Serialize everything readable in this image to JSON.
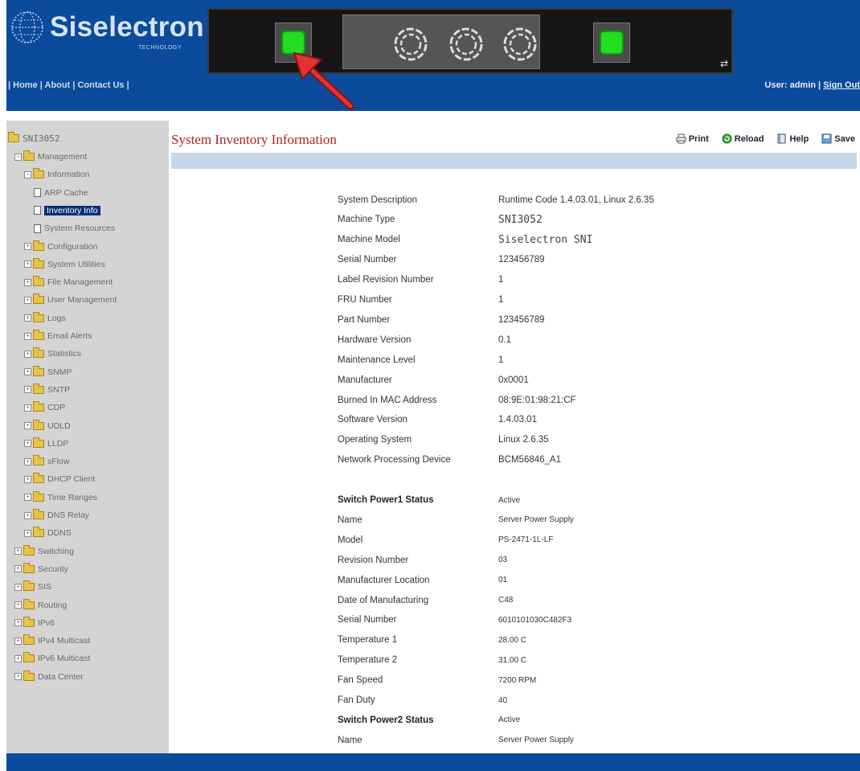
{
  "brand": {
    "name": "Siselectron",
    "subtitle": "TECHNOLOGY"
  },
  "header_nav": {
    "home": "Home",
    "about": "About",
    "contact": "Contact Us",
    "sep": "|"
  },
  "user_area": {
    "label": "User: admin",
    "sep": "|",
    "sign_out": "Sign Out"
  },
  "device_panel": {
    "psu_icon": "power-supply-icon",
    "fan_icon": "fan-icon",
    "sync_glyph": "⇄"
  },
  "sidebar": {
    "root": "SNI3052",
    "items": [
      {
        "label": "Management",
        "type": "folder",
        "expand": "−"
      },
      {
        "label": "Information",
        "type": "folder",
        "expand": "−"
      },
      {
        "label": "ARP Cache",
        "type": "page"
      },
      {
        "label": "Inventory Info",
        "type": "page",
        "selected": true
      },
      {
        "label": "System Resources",
        "type": "page"
      },
      {
        "label": "Configuration",
        "type": "folder",
        "expand": "+"
      },
      {
        "label": "System Utilities",
        "type": "folder",
        "expand": "+"
      },
      {
        "label": "File Management",
        "type": "folder",
        "expand": "+"
      },
      {
        "label": "User Management",
        "type": "folder",
        "expand": "+"
      },
      {
        "label": "Logs",
        "type": "folder",
        "expand": "+"
      },
      {
        "label": "Email Alerts",
        "type": "folder",
        "expand": "+"
      },
      {
        "label": "Statistics",
        "type": "folder",
        "expand": "+"
      },
      {
        "label": "SNMP",
        "type": "folder",
        "expand": "+"
      },
      {
        "label": "SNTP",
        "type": "folder",
        "expand": "+"
      },
      {
        "label": "CDP",
        "type": "folder",
        "expand": "+"
      },
      {
        "label": "UDLD",
        "type": "folder",
        "expand": "+"
      },
      {
        "label": "LLDP",
        "type": "folder",
        "expand": "+"
      },
      {
        "label": "sFlow",
        "type": "folder",
        "expand": "+"
      },
      {
        "label": "DHCP Client",
        "type": "folder",
        "expand": "+"
      },
      {
        "label": "Time Ranges",
        "type": "folder",
        "expand": "+"
      },
      {
        "label": "DNS Relay",
        "type": "folder",
        "expand": "+"
      },
      {
        "label": "DDNS",
        "type": "folder",
        "expand": "+"
      },
      {
        "label": "Switching",
        "type": "folder",
        "expand": "+"
      },
      {
        "label": "Security",
        "type": "folder",
        "expand": "+"
      },
      {
        "label": "SIS",
        "type": "folder",
        "expand": "+"
      },
      {
        "label": "Routing",
        "type": "folder",
        "expand": "+"
      },
      {
        "label": "IPv6",
        "type": "folder",
        "expand": "+"
      },
      {
        "label": "IPv4 Multicast",
        "type": "folder",
        "expand": "+"
      },
      {
        "label": "IPv6 Multicast",
        "type": "folder",
        "expand": "+"
      },
      {
        "label": "Data Center",
        "type": "folder",
        "expand": "+"
      }
    ]
  },
  "main": {
    "title": "System Inventory Information",
    "toolbar": {
      "print": "Print",
      "reload": "Reload",
      "help": "Help",
      "save": "Save"
    },
    "rows": [
      {
        "label": "System Description",
        "value": "Runtime Code 1.4.03.01, Linux 2.6.35"
      },
      {
        "label": "Machine Type",
        "value": "SNI3052",
        "style": "mono"
      },
      {
        "label": "Machine Model",
        "value": "Siselectron SNI",
        "style": "mono"
      },
      {
        "label": "Serial Number",
        "value": "123456789"
      },
      {
        "label": "Label Revision Number",
        "value": "1"
      },
      {
        "label": "FRU Number",
        "value": "1"
      },
      {
        "label": "Part Number",
        "value": "123456789"
      },
      {
        "label": "Hardware Version",
        "value": "0.1"
      },
      {
        "label": "Maintenance Level",
        "value": "1"
      },
      {
        "label": "Manufacturer",
        "value": "0x0001"
      },
      {
        "label": "Burned In MAC Address",
        "value": "08:9E:01:98:21:CF"
      },
      {
        "label": "Software Version",
        "value": "1.4.03.01"
      },
      {
        "label": "Operating System",
        "value": "Linux 2.6.35"
      },
      {
        "label": "Network Processing Device",
        "value": "BCM56846_A1"
      },
      {
        "label": "",
        "value": ""
      },
      {
        "label": "Switch Power1 Status",
        "value": "Active",
        "style": "header"
      },
      {
        "label": "Name",
        "value": "Server Power Supply",
        "style": "small"
      },
      {
        "label": "Model",
        "value": "PS-2471-1L-LF",
        "style": "small"
      },
      {
        "label": "Revision Number",
        "value": "03",
        "style": "small"
      },
      {
        "label": "Manufacturer Location",
        "value": "01",
        "style": "small"
      },
      {
        "label": "Date of Manufacturing",
        "value": "C48",
        "style": "small"
      },
      {
        "label": "Serial Number",
        "value": "6010101030C482F3",
        "style": "small"
      },
      {
        "label": "Temperature 1",
        "value": "28.00 C",
        "style": "small"
      },
      {
        "label": "Temperature 2",
        "value": "31.00 C",
        "style": "small"
      },
      {
        "label": "Fan Speed",
        "value": "7200 RPM",
        "style": "small"
      },
      {
        "label": "Fan Duty",
        "value": "40",
        "style": "small"
      },
      {
        "label": "Switch Power2 Status",
        "value": "Active",
        "style": "header"
      },
      {
        "label": "Name",
        "value": "Server Power Supply",
        "style": "small"
      }
    ]
  },
  "colors": {
    "header_bg": "#0a4b9c",
    "title_red": "#b52020",
    "sidebar_bg": "#d4d4d4",
    "bar_blue": "#c5d7e8",
    "psu_green": "#22dd22"
  }
}
